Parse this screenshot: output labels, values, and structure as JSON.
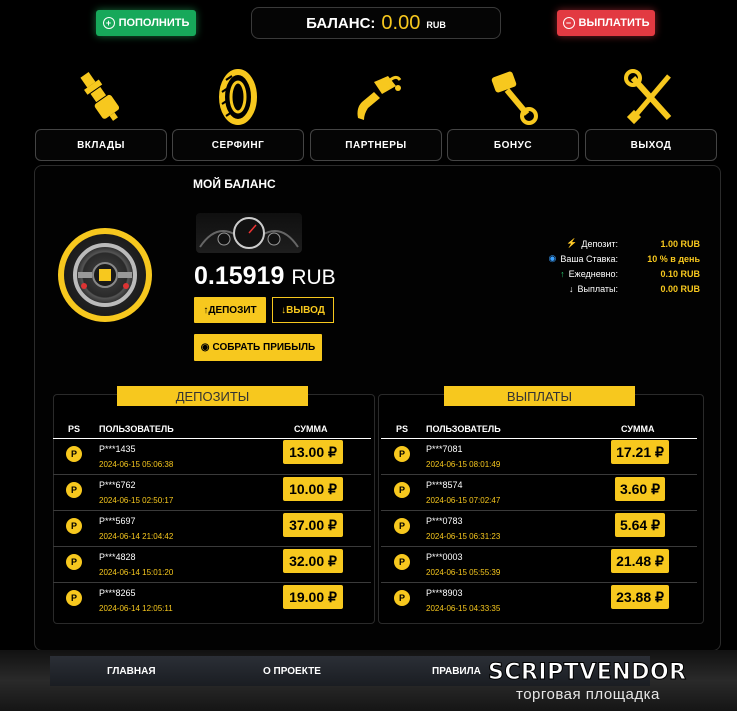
{
  "header": {
    "refill_label": "ПОПОЛНИТЬ",
    "balance_label": "БАЛАНС:",
    "balance_value": "0.00",
    "balance_currency": "RUB",
    "withdraw_label": "ВЫПЛАТИТЬ"
  },
  "nav": {
    "items": [
      {
        "label": "ВКЛАДЫ",
        "icon": "spark-plug-icon"
      },
      {
        "label": "СЕРФИНГ",
        "icon": "tire-icon"
      },
      {
        "label": "ПАРТНЕРЫ",
        "icon": "fuel-nozzle-icon"
      },
      {
        "label": "БОНУС",
        "icon": "piston-icon"
      },
      {
        "label": "ВЫХОД",
        "icon": "wrench-screwdriver-icon"
      }
    ]
  },
  "balance": {
    "title": "МОЙ БАЛАНС",
    "amount": "0.15919",
    "unit": "RUB",
    "deposit_btn": "ДЕПОЗИТ",
    "withdraw_btn": "ВЫВОД",
    "collect_btn": "СОБРАТЬ ПРИБЫЛЬ"
  },
  "stats": [
    {
      "label": "Депозит:",
      "value": "1.00 RUB",
      "icon": "lightning-icon",
      "color": "#f7c81e"
    },
    {
      "label": "Ваша Ставка:",
      "value": "10 % в день",
      "icon": "coins-icon",
      "color": "#3aa0ff"
    },
    {
      "label": "Ежедневно:",
      "value": "0.10 RUB",
      "icon": "arrow-up-icon",
      "color": "#2ecc71"
    },
    {
      "label": "Выплаты:",
      "value": "0.00 RUB",
      "icon": "arrow-down-icon",
      "color": "#ffffff"
    }
  ],
  "deposits": {
    "title": "ДЕПОЗИТЫ",
    "headers": {
      "ps": "PS",
      "user": "ПОЛЬЗОВАТЕЛЬ",
      "sum": "СУММА"
    },
    "rows": [
      {
        "user": "P***1435",
        "date": "2024-06-15 05:06:38",
        "amount": "13.00 ₽"
      },
      {
        "user": "P***6762",
        "date": "2024-06-15 02:50:17",
        "amount": "10.00 ₽"
      },
      {
        "user": "P***5697",
        "date": "2024-06-14 21:04:42",
        "amount": "37.00 ₽"
      },
      {
        "user": "P***4828",
        "date": "2024-06-14 15:01:20",
        "amount": "32.00 ₽"
      },
      {
        "user": "P***8265",
        "date": "2024-06-14 12:05:11",
        "amount": "19.00 ₽"
      }
    ]
  },
  "payouts": {
    "title": "ВЫПЛАТЫ",
    "headers": {
      "ps": "PS",
      "user": "ПОЛЬЗОВАТЕЛЬ",
      "sum": "СУММА"
    },
    "rows": [
      {
        "user": "P***7081",
        "date": "2024-06-15 08:01:49",
        "amount": "17.21 ₽"
      },
      {
        "user": "P***8574",
        "date": "2024-06-15 07:02:47",
        "amount": "3.60 ₽"
      },
      {
        "user": "P***0783",
        "date": "2024-06-15 06:31:23",
        "amount": "5.64 ₽"
      },
      {
        "user": "P***0003",
        "date": "2024-06-15 05:55:39",
        "amount": "21.48 ₽"
      },
      {
        "user": "P***8903",
        "date": "2024-06-15 04:33:35",
        "amount": "23.88 ₽"
      }
    ]
  },
  "coin_letter": "P",
  "footer": {
    "home": "ГЛАВНАЯ",
    "about": "О ПРОЕКТЕ",
    "rules": "ПРАВИЛА"
  },
  "watermark": {
    "brand": "SCRIPTVENDOR",
    "tagline": "торговая площадка"
  }
}
